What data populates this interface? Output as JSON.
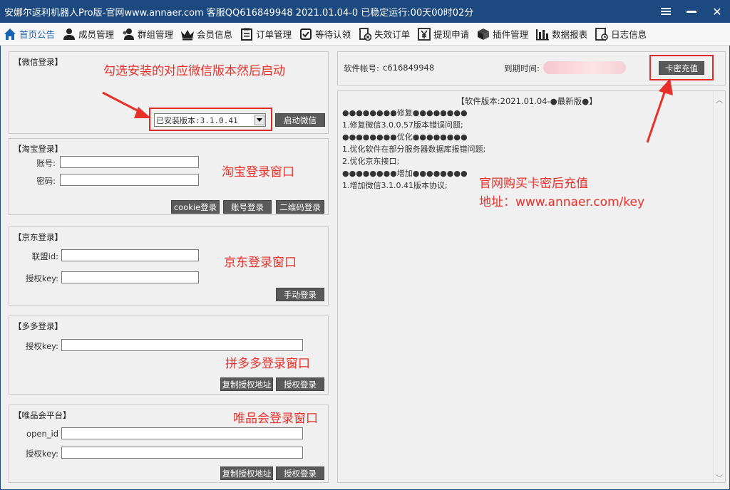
{
  "window": {
    "title": "安娜尔返利机器人Pro版-官网www.annaer.com 客服QQ616849948  2021.01.04-0  已稳定运行:00天00时02分"
  },
  "toolbar": {
    "items": [
      {
        "label": "首页公告",
        "icon": "home-icon"
      },
      {
        "label": "成员管理",
        "icon": "user-icon"
      },
      {
        "label": "群组管理",
        "icon": "group-icon"
      },
      {
        "label": "会员信息",
        "icon": "crown-icon"
      },
      {
        "label": "订单管理",
        "icon": "list-icon"
      },
      {
        "label": "等待认领",
        "icon": "handshake-icon"
      },
      {
        "label": "失效订单",
        "icon": "invalid-order-icon"
      },
      {
        "label": "提现申请",
        "icon": "yuan-icon"
      },
      {
        "label": "插件管理",
        "icon": "cube-icon"
      },
      {
        "label": "数据报表",
        "icon": "bar-chart-icon"
      },
      {
        "label": "日志信息",
        "icon": "log-icon"
      }
    ]
  },
  "wechat": {
    "title": "【微信登录】",
    "version_select": "已安装版本:3.1.0.41",
    "start_button": "启动微信",
    "annotation": "勾选安装的对应微信版本然后启动"
  },
  "taobao": {
    "title": "【淘宝登录】",
    "account_label": "账号:",
    "password_label": "密码:",
    "cookie_button": "cookie登录",
    "account_button": "账号登录",
    "qrcode_button": "二维码登录",
    "annotation": "淘宝登录窗口"
  },
  "jd": {
    "title": "【京东登录】",
    "union_label": "联盟id:",
    "key_label": "授权key:",
    "manual_button": "手动登录",
    "annotation": "京东登录窗口"
  },
  "pdd": {
    "title": "【多多登录】",
    "key_label": "授权key:",
    "copy_button": "复制授权地址",
    "auth_button": "授权登录",
    "annotation": "拼多多登录窗口"
  },
  "vip": {
    "title": "【唯品会平台】",
    "openid_label": "open_id",
    "key_label": "授权key:",
    "copy_button": "复制授权地址",
    "auth_button": "授权登录",
    "annotation": "唯品会登录窗口"
  },
  "account": {
    "software_account_label": "软件帐号:",
    "software_account_value": "c616849948",
    "expire_label": "到期时间:",
    "recharge_button": "卡密充值"
  },
  "notice": {
    "title": "【软件版本:2021.01.04-●最新版●】",
    "lines": [
      "●●●●●●●●修复●●●●●●●●",
      "1.修复微信3.0.0.57版本错误问题;",
      "●●●●●●●●优化●●●●●●●●",
      "1.优化软件在部分服务器数据库报错问题;",
      "2.优化京东接口;",
      "●●●●●●●●增加●●●●●●●●",
      "1.增加微信3.1.0.41版本协议;"
    ],
    "annotation_line1": "官网购买卡密后充值",
    "annotation_line2": "地址：www.annaer.com/key"
  },
  "colors": {
    "titlebar": "#1c4a80",
    "annotation_red": "#e8302a",
    "accent_blue": "#1a63b3"
  }
}
